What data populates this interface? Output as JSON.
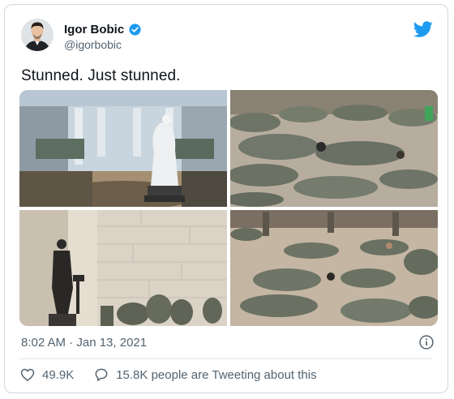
{
  "tweet": {
    "author_name": "Igor Bobic",
    "author_handle": "@igorbobic",
    "text": "Stunned. Just stunned.",
    "timestamp": "8:02 AM · Jan 13, 2021",
    "likes": "49.9K",
    "replies_text": "15.8K people are Tweeting about this"
  },
  "icons": {
    "verified": "verified-badge-icon",
    "brand": "twitter-bird-icon",
    "info": "info-icon",
    "like": "heart-icon",
    "reply": "speech-bubble-icon"
  },
  "colors": {
    "brand_blue": "#1d9bf0",
    "text_primary": "#0f1419",
    "text_secondary": "#536471",
    "border": "#cfd9de"
  }
}
